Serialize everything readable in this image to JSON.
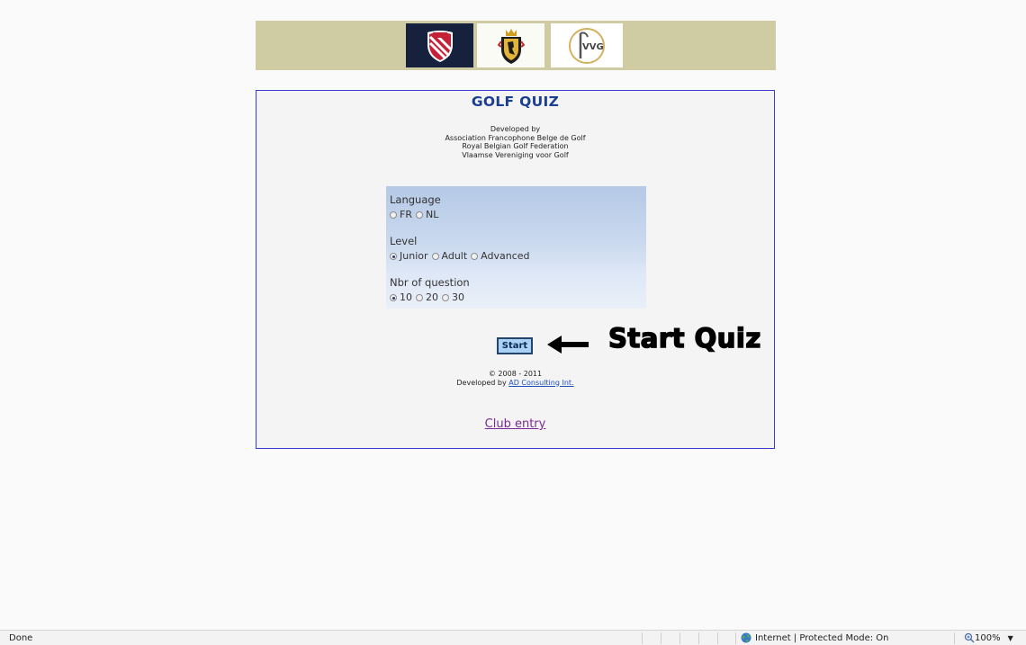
{
  "title": "GOLF QUIZ",
  "credits": [
    "Developed by",
    "Association Francophone Belge de Golf",
    "Royal Belgian Golf Federation",
    "Vlaamse Vereniging voor Golf"
  ],
  "logos": {
    "vvg_text": "VVG"
  },
  "options": {
    "language": {
      "label": "Language",
      "choices": [
        "FR",
        "NL"
      ],
      "selected": null
    },
    "level": {
      "label": "Level",
      "choices": [
        "Junior",
        "Adult",
        "Advanced"
      ],
      "selected": "Junior"
    },
    "questions": {
      "label": "Nbr of question",
      "choices": [
        "10",
        "20",
        "30"
      ],
      "selected": "10"
    }
  },
  "start_label": "Start",
  "copyright": {
    "years": "© 2008 - 2011",
    "developed_by": "Developed by",
    "company": "AD Consulting Int."
  },
  "club_entry": "Club entry",
  "annotation": "Start Quiz",
  "statusbar": {
    "left": "Done",
    "zone": "Internet | Protected Mode: On",
    "zoom": "100%"
  },
  "colors": {
    "banner": "#cfcca4",
    "title": "#1d3f91",
    "frame_border": "#3a3acd",
    "link": "#7a2a96",
    "start_bg": "#a9d0f5"
  }
}
